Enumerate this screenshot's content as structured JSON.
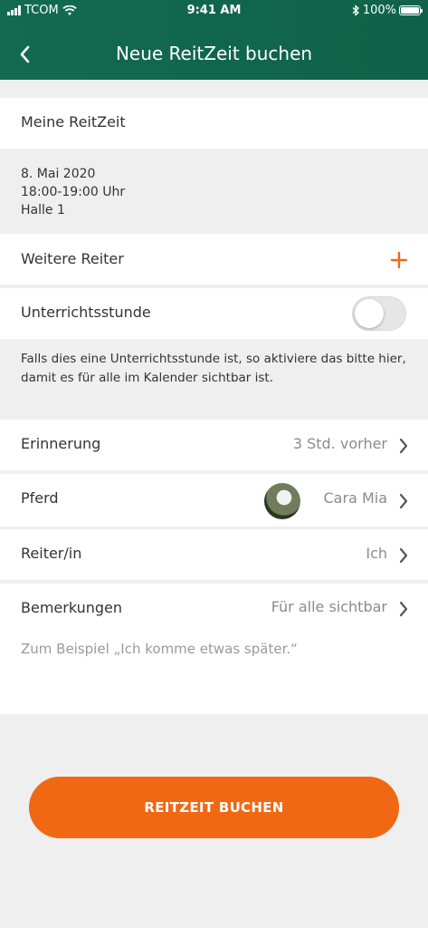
{
  "status_bar": {
    "carrier": "TCOM",
    "time": "9:41 AM",
    "battery": "100%"
  },
  "header": {
    "title": "Neue ReitZeit buchen"
  },
  "my_ride": {
    "heading": "Meine ReitZeit",
    "date": "8. Mai 2020",
    "time": "18:00-19:00 Uhr",
    "place": "Halle 1"
  },
  "more_riders": {
    "label": "Weitere Reiter"
  },
  "lesson": {
    "label": "Unterrichtsstunde",
    "enabled": false,
    "hint": "Falls dies eine Unterrichtsstunde ist, so aktiviere das bitte hier, damit es für alle im Kalender sichtbar ist."
  },
  "rows": {
    "reminder": {
      "label": "Erinnerung",
      "value": "3 Std. vorher"
    },
    "horse": {
      "label": "Pferd",
      "value": "Cara Mia"
    },
    "rider": {
      "label": "Reiter/in",
      "value": "Ich"
    },
    "remarks": {
      "label": "Bemerkungen",
      "value": "Für alle sichtbar",
      "placeholder": "Zum Beispiel „Ich komme etwas später.“"
    }
  },
  "button": {
    "label": "REITZEIT BUCHEN"
  },
  "colors": {
    "header": "#126b4f",
    "accent": "#f06814",
    "background": "#efefef"
  }
}
